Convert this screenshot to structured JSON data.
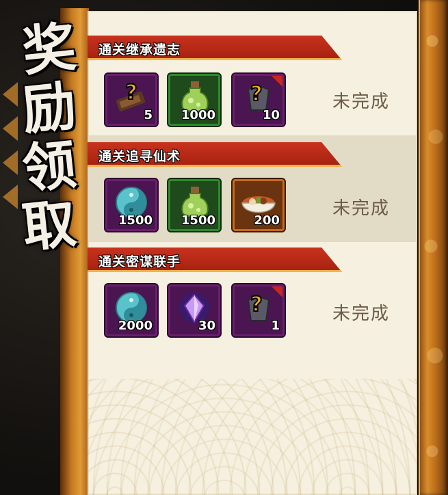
{
  "title_chars": [
    "奖",
    "励",
    "领",
    "取"
  ],
  "sections": [
    {
      "name": "通关继承遗志",
      "status": "未完成",
      "items": [
        {
          "icon": "mystery-scroll-icon",
          "qty": "5"
        },
        {
          "icon": "green-potion-icon",
          "qty": "1000"
        },
        {
          "icon": "mystery-armor-icon",
          "qty": "10"
        }
      ]
    },
    {
      "name": "通关追寻仙术",
      "status": "未完成",
      "items": [
        {
          "icon": "yin-yang-orb-icon",
          "qty": "1500"
        },
        {
          "icon": "green-potion-icon",
          "qty": "1500"
        },
        {
          "icon": "ramen-bowl-icon",
          "qty": "200"
        }
      ]
    },
    {
      "name": "通关密谋联手",
      "status": "未完成",
      "items": [
        {
          "icon": "yin-yang-orb-icon",
          "qty": "2000"
        },
        {
          "icon": "purple-crystal-icon",
          "qty": "30"
        },
        {
          "icon": "mystery-armor-icon",
          "qty": "1"
        }
      ]
    }
  ],
  "colors": {
    "banner_red": "#b82a16",
    "panel_cream": "#f5f0df",
    "status_text": "#6b5a46"
  }
}
